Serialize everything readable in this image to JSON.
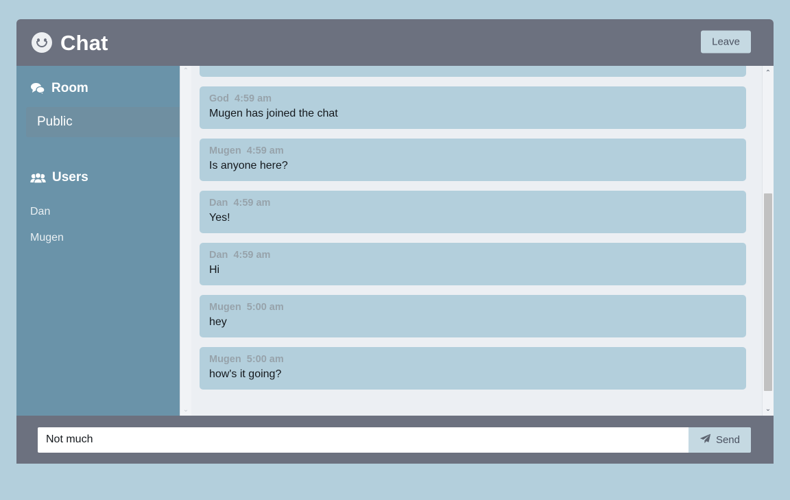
{
  "header": {
    "title": "Chat",
    "logo_icon": "smiley-face-icon",
    "leave_label": "Leave"
  },
  "sidebar": {
    "room_heading": "Room",
    "room_icon": "comments-icon",
    "rooms": [
      {
        "label": "Public",
        "selected": true
      }
    ],
    "users_heading": "Users",
    "users_icon": "users-group-icon",
    "users": [
      {
        "name": "Dan"
      },
      {
        "name": "Mugen"
      }
    ]
  },
  "messages": [
    {
      "user": "God",
      "time": "4:59 am",
      "text": "Mugen has joined the chat"
    },
    {
      "user": "Mugen",
      "time": "4:59 am",
      "text": "Is anyone here?"
    },
    {
      "user": "Dan",
      "time": "4:59 am",
      "text": "Yes!"
    },
    {
      "user": "Dan",
      "time": "4:59 am",
      "text": "Hi"
    },
    {
      "user": "Mugen",
      "time": "5:00 am",
      "text": "hey"
    },
    {
      "user": "Mugen",
      "time": "5:00 am",
      "text": "how's it going?"
    }
  ],
  "composer": {
    "input_value": "Not much",
    "input_placeholder": "",
    "send_label": "Send",
    "send_icon": "paper-plane-icon"
  },
  "scrollbars": {
    "up_arrow": "⌃",
    "down_arrow": "⌄"
  },
  "colors": {
    "page_background": "#b3cfdc",
    "header": "#6c717f",
    "sidebar": "#6a93a9",
    "room_selected": "#6f8fa1",
    "message_panel": "#eceff3",
    "bubble": "#b3cfdc",
    "accent_button": "#c5d9e2"
  }
}
